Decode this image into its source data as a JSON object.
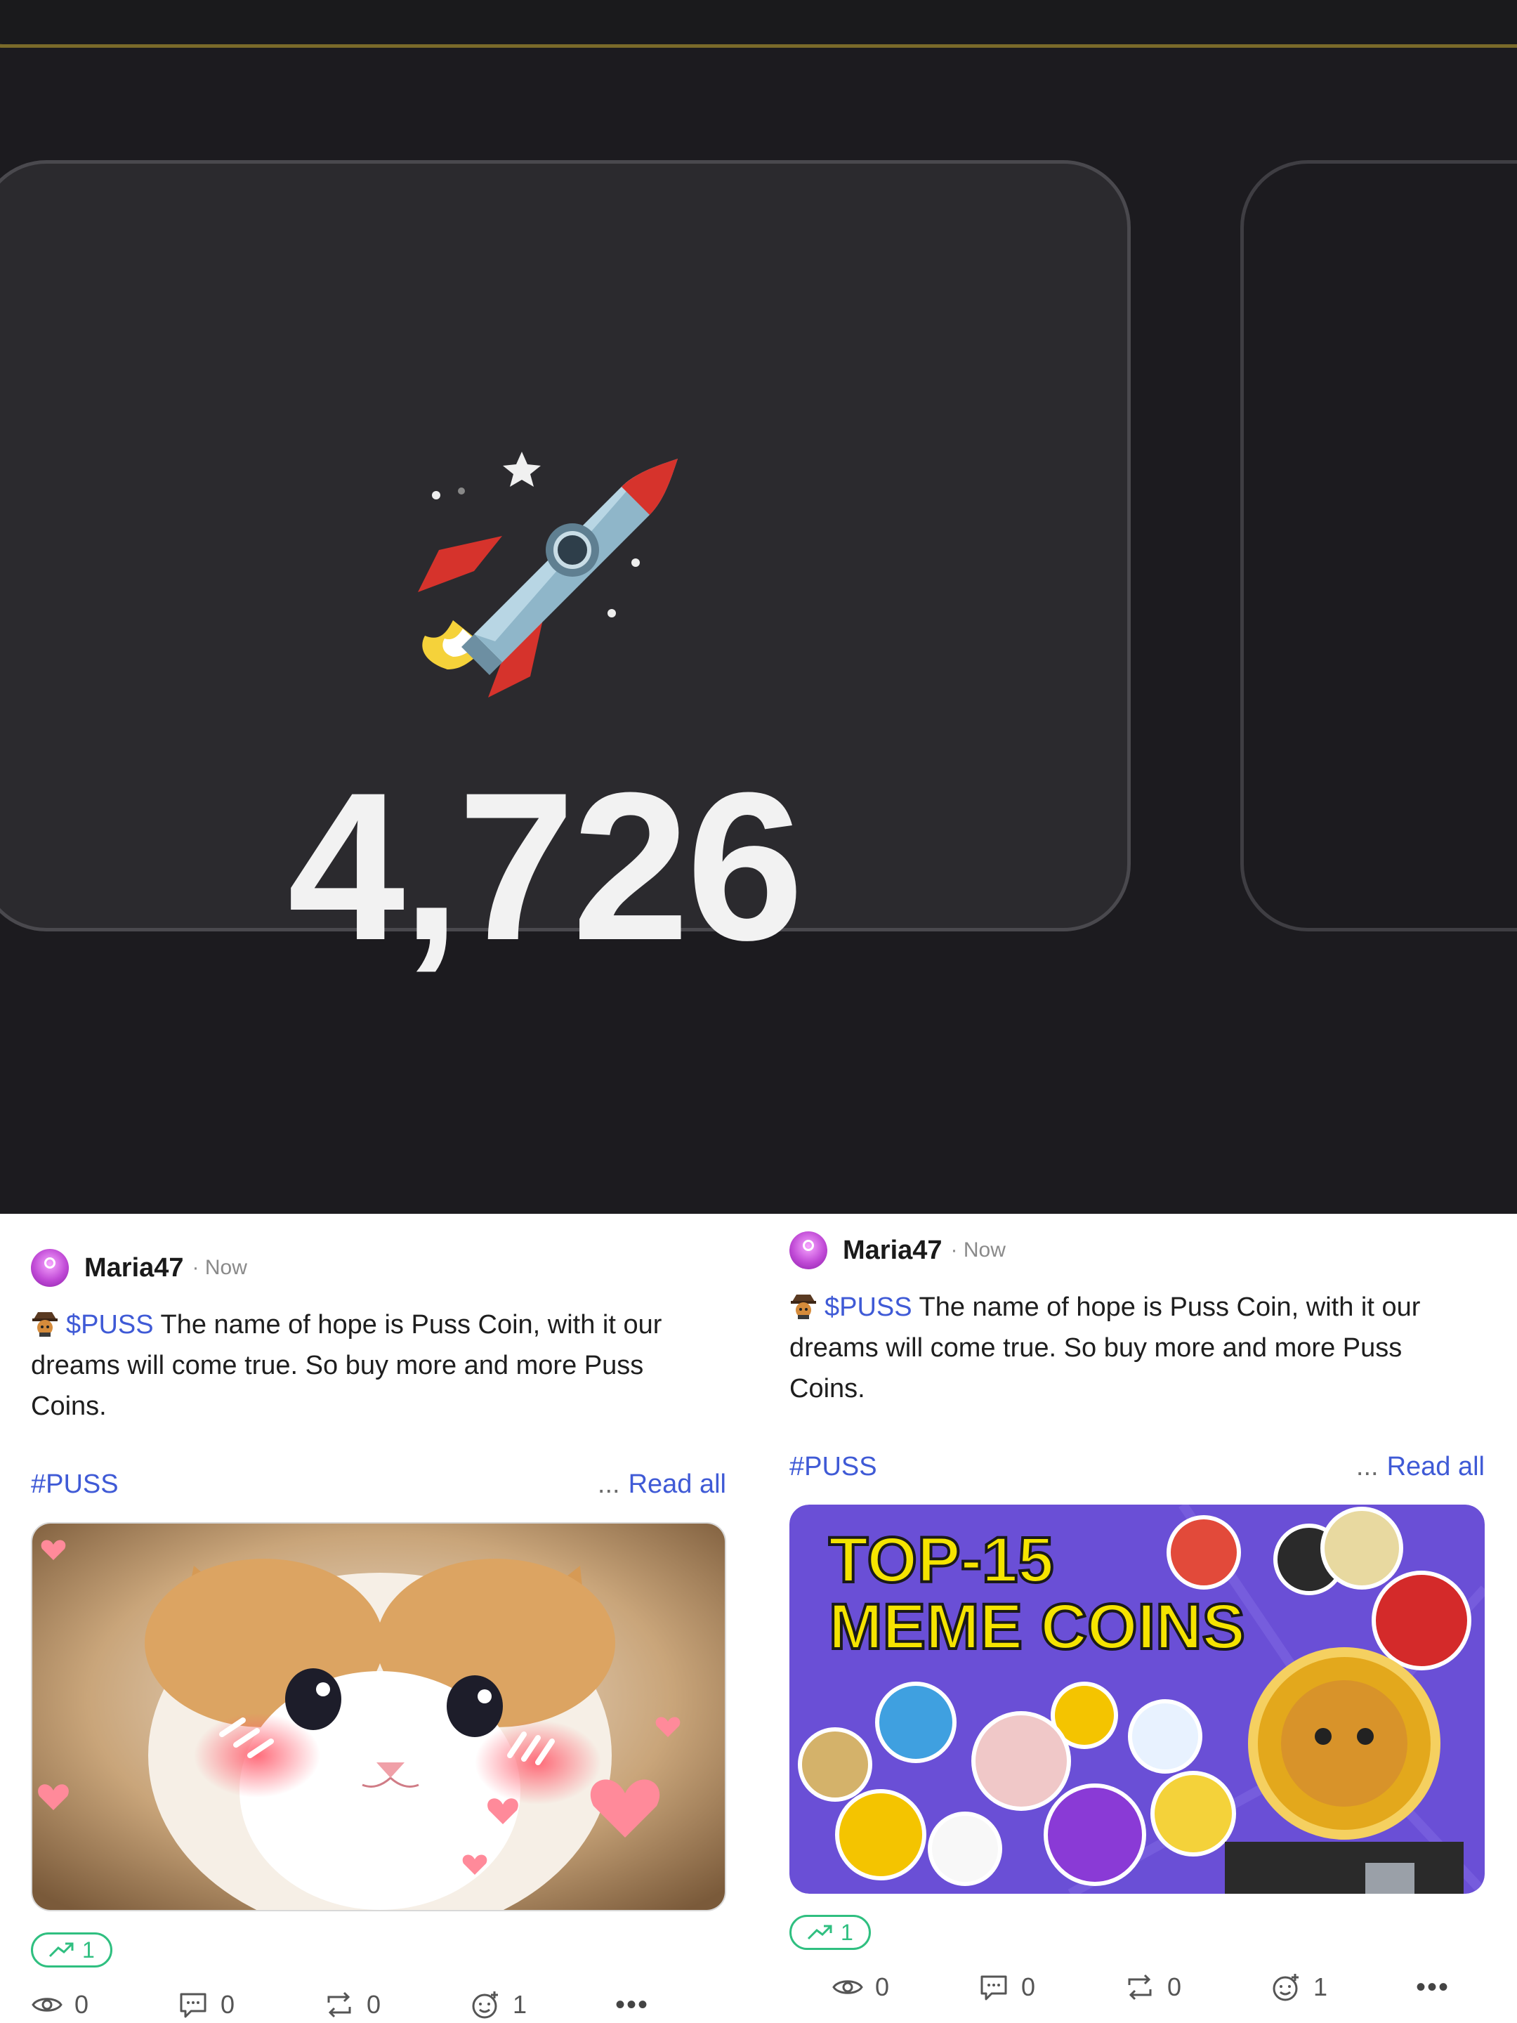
{
  "stats": {
    "counter_value": "4,726"
  },
  "posts": [
    {
      "author": "Maria47",
      "time": "· Now",
      "ticker": "$PUSS",
      "body": "The name of hope is Puss Coin, with it our dreams will come true. So buy more and more Puss Coins.",
      "hashtag": "#PUSS",
      "read_more_dots": "...",
      "read_more": "Read all",
      "image": "kitten-photo",
      "trend_count": "1",
      "views": "0",
      "comments": "0",
      "reposts": "0",
      "reactions": "1",
      "more": "•••"
    },
    {
      "author": "Maria47",
      "time": "· Now",
      "ticker": "$PUSS",
      "body": "The name of hope is Puss Coin, with it our dreams will come true. So buy more and more Puss Coins.",
      "hashtag": "#PUSS",
      "read_more_dots": "...",
      "read_more": "Read all",
      "image": "meme-coins-banner",
      "image_text": "TOP-15\nMEME COINS",
      "image_line1": "TOP-15",
      "image_line2": "MEME COINS",
      "trend_count": "1",
      "views": "0",
      "comments": "0",
      "reposts": "0",
      "reactions": "1",
      "more": "•••"
    }
  ],
  "colors": {
    "accent_link": "#3f5ad6",
    "trend_green": "#2fbf80",
    "dark_bg": "#1c1b1f"
  }
}
